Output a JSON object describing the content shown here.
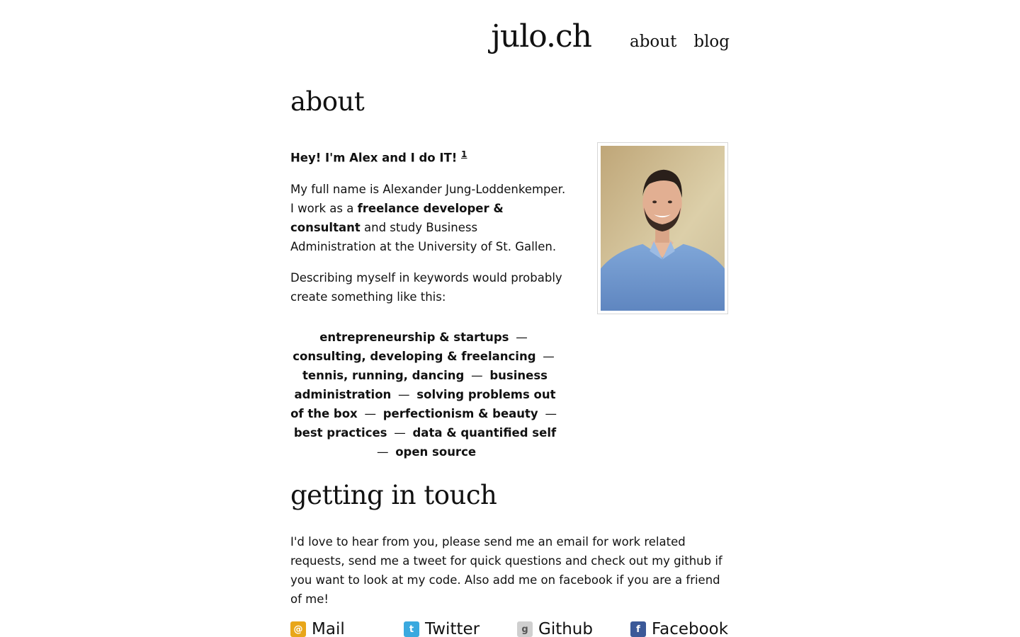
{
  "header": {
    "site_title": "julo.ch",
    "nav": [
      {
        "label": "about"
      },
      {
        "label": "blog"
      }
    ]
  },
  "about": {
    "title": "about",
    "lead": "Hey! I'm Alex and I do IT!",
    "footnote": "1",
    "intro_part1": "My full name is Alexander Jung-Loddenkemper. I work as a ",
    "intro_bold": "freelance developer & consultant",
    "intro_part2": " and study Business Administration at the University of St. Gallen.",
    "keywords_intro": "Describing myself in keywords would probably create something like this:",
    "keywords": [
      "entrepreneurship & startups",
      "consulting, developing & freelancing",
      "tennis, running, dancing",
      "business administration",
      "solving problems out of the box",
      "perfectionism & beauty",
      "best practices",
      "data & quantified self",
      "open source"
    ],
    "separator": "—"
  },
  "touch": {
    "title": "getting in touch",
    "text": "I'd love to hear from you, please send me an email for work related requests, send me a tweet for quick questions and check out my github if you want to look at my code. Also add me on facebook if you are a friend of me!",
    "contacts": [
      {
        "label": "Mail",
        "icon": "mail-icon",
        "glyph": "@",
        "color": "#e8a619"
      },
      {
        "label": "Twitter",
        "icon": "twitter-icon",
        "glyph": "t",
        "color": "#3aa9df"
      },
      {
        "label": "Github",
        "icon": "github-icon",
        "glyph": "g",
        "color": "#cfcfcf"
      },
      {
        "label": "Facebook",
        "icon": "facebook-icon",
        "glyph": "f",
        "color": "#3b5998"
      }
    ]
  }
}
